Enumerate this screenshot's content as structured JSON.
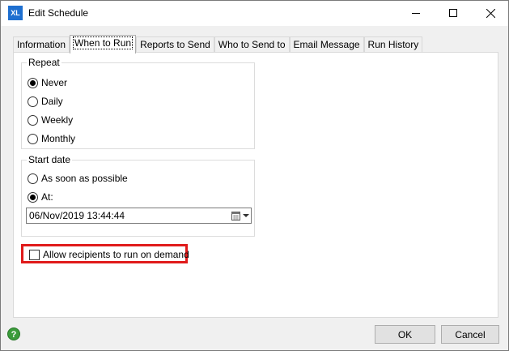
{
  "window": {
    "title": "Edit Schedule",
    "app_icon_text": "XL",
    "controls": [
      "minimize",
      "maximize",
      "close"
    ]
  },
  "tabs": [
    {
      "label": "Information",
      "active": false
    },
    {
      "label": "When to Run",
      "active": true
    },
    {
      "label": "Reports to Send",
      "active": false
    },
    {
      "label": "Who to Send to",
      "active": false
    },
    {
      "label": "Email Message",
      "active": false
    },
    {
      "label": "Run History",
      "active": false
    }
  ],
  "repeat": {
    "legend": "Repeat",
    "options": [
      {
        "label": "Never",
        "checked": true
      },
      {
        "label": "Daily",
        "checked": false
      },
      {
        "label": "Weekly",
        "checked": false
      },
      {
        "label": "Monthly",
        "checked": false
      }
    ]
  },
  "start_date": {
    "legend": "Start date",
    "options": [
      {
        "label": "As soon as possible",
        "checked": false
      },
      {
        "label": "At:",
        "checked": true
      }
    ],
    "date_value": "06/Nov/2019 13:44:44"
  },
  "allow_on_demand": {
    "label": "Allow recipients to run on demand",
    "checked": false,
    "highlight_color": "#e01b1b"
  },
  "footer": {
    "help_icon": "?",
    "ok_label": "OK",
    "cancel_label": "Cancel"
  }
}
